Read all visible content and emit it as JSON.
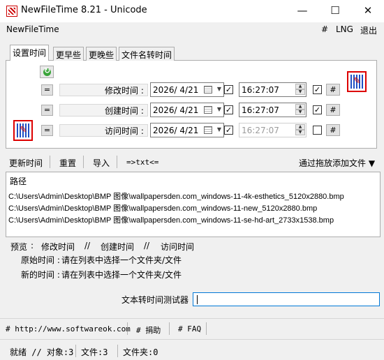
{
  "window": {
    "title": "NewFileTime 8.21 - Unicode",
    "minimize": "—",
    "maximize": "☐",
    "close": "✕"
  },
  "menu": {
    "app": "NewFileTime",
    "hash": "#",
    "lng": "LNG",
    "exit": "退出"
  },
  "tabs": [
    "设置时间",
    "更早些",
    "更晚些",
    "文件名转时间"
  ],
  "time_rows": [
    {
      "eq": "=",
      "label": "修改时间 :",
      "date": "2026/ 4/21",
      "date_checked": true,
      "time": "16:27:07",
      "time_checked": true,
      "time_enabled": true,
      "hash": "#"
    },
    {
      "eq": "=",
      "label": "创建时间 :",
      "date": "2026/ 4/21",
      "date_checked": true,
      "time": "16:27:07",
      "time_checked": true,
      "time_enabled": true,
      "hash": "#"
    },
    {
      "eq": "=",
      "label": "访问时间 :",
      "date": "2026/ 4/21",
      "date_checked": true,
      "time": "16:27:07",
      "time_checked": false,
      "time_enabled": false,
      "hash": "#"
    }
  ],
  "checkmark": "✓",
  "toolbar": {
    "update": "更新时间",
    "reset": "重置",
    "import": "导入",
    "txt": "=>txt<=",
    "drag_add": "通过拖放添加文件 ▼"
  },
  "list": {
    "header": "路径",
    "rows": [
      "C:\\Users\\Admin\\Desktop\\BMP 图像\\wallpapersden.com_windows-11-4k-esthetics_5120x2880.bmp",
      "C:\\Users\\Admin\\Desktop\\BMP 图像\\wallpapersden.com_windows-11-new_5120x2880.bmp",
      "C:\\Users\\Admin\\Desktop\\BMP 图像\\wallpapersden.com_windows-11-se-hd-art_2733x1538.bmp"
    ]
  },
  "preview": {
    "label": "预览",
    "sep": ":",
    "modified": "修改时间",
    "created": "创建时间",
    "accessed": "访问时间",
    "slashes": "//",
    "original_label": "原始时间 :",
    "original_value": "请在列表中选择一个文件夹/文件",
    "new_label": "新的时间 :",
    "new_value": "请在列表中选择一个文件夹/文件"
  },
  "tester": {
    "label": "文本转时间测试器",
    "value": ""
  },
  "links": {
    "website": "# http://www.softwareok.com",
    "donate": "# 捐助",
    "faq": "# FAQ"
  },
  "status": {
    "ready": "就绪 // 对象:3",
    "files": "文件:3",
    "folders": "文件夹:0"
  }
}
